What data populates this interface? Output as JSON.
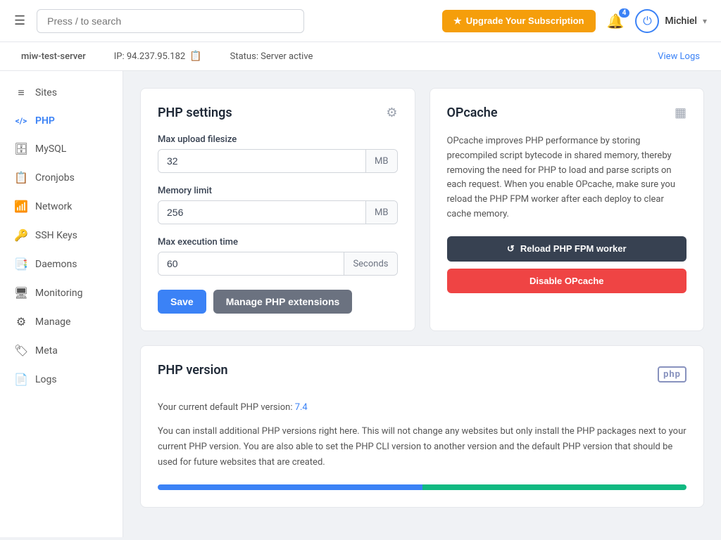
{
  "navbar": {
    "menu_label": "Menu",
    "search_placeholder": "Press / to search",
    "upgrade_label": "Upgrade Your Subscription",
    "notification_count": "4",
    "username": "Michiel",
    "chevron": "▾"
  },
  "server_bar": {
    "server_name": "miw-test-server",
    "ip_label": "IP: 94.237.95.182",
    "status": "Status: Server active",
    "view_logs": "View Logs"
  },
  "sidebar": {
    "items": [
      {
        "id": "sites",
        "label": "Sites",
        "icon": "≡"
      },
      {
        "id": "php",
        "label": "PHP",
        "icon": "</>"
      },
      {
        "id": "mysql",
        "label": "MySQL",
        "icon": "🗄"
      },
      {
        "id": "cronjobs",
        "label": "Cronjobs",
        "icon": "📋"
      },
      {
        "id": "network",
        "label": "Network",
        "icon": "📶"
      },
      {
        "id": "ssh-keys",
        "label": "SSH Keys",
        "icon": "🔑"
      },
      {
        "id": "daemons",
        "label": "Daemons",
        "icon": "📑"
      },
      {
        "id": "monitoring",
        "label": "Monitoring",
        "icon": "🖥"
      },
      {
        "id": "manage",
        "label": "Manage",
        "icon": "⚙"
      },
      {
        "id": "meta",
        "label": "Meta",
        "icon": "🏷"
      },
      {
        "id": "logs",
        "label": "Logs",
        "icon": "📄"
      }
    ]
  },
  "php_settings": {
    "title": "PHP settings",
    "max_upload_label": "Max upload filesize",
    "max_upload_value": "32",
    "max_upload_suffix": "MB",
    "memory_limit_label": "Memory limit",
    "memory_limit_value": "256",
    "memory_limit_suffix": "MB",
    "max_execution_label": "Max execution time",
    "max_execution_value": "60",
    "max_execution_suffix": "Seconds",
    "save_label": "Save",
    "manage_extensions_label": "Manage PHP extensions"
  },
  "opcache": {
    "title": "OPcache",
    "description": "OPcache improves PHP performance by storing precompiled script bytecode in shared memory, thereby removing the need for PHP to load and parse scripts on each request. When you enable OPcache, make sure you reload the PHP FPM worker after each deploy to clear cache memory.",
    "reload_label": "Reload PHP FPM worker",
    "disable_label": "Disable OPcache"
  },
  "php_version": {
    "title": "PHP version",
    "current_version_prefix": "Your current default PHP version: ",
    "current_version": "7.4",
    "description": "You can install additional PHP versions right here. This will not change any websites but only install the PHP packages next to your current PHP version. You are also able to set the PHP CLI version to another version and the default PHP version that should be used for future websites that are created."
  },
  "icons": {
    "menu": "☰",
    "star": "★",
    "bell": "🔔",
    "power": "⏻",
    "copy": "📋",
    "gear": "⚙",
    "grid": "▦",
    "refresh": "↺",
    "php": "php"
  }
}
